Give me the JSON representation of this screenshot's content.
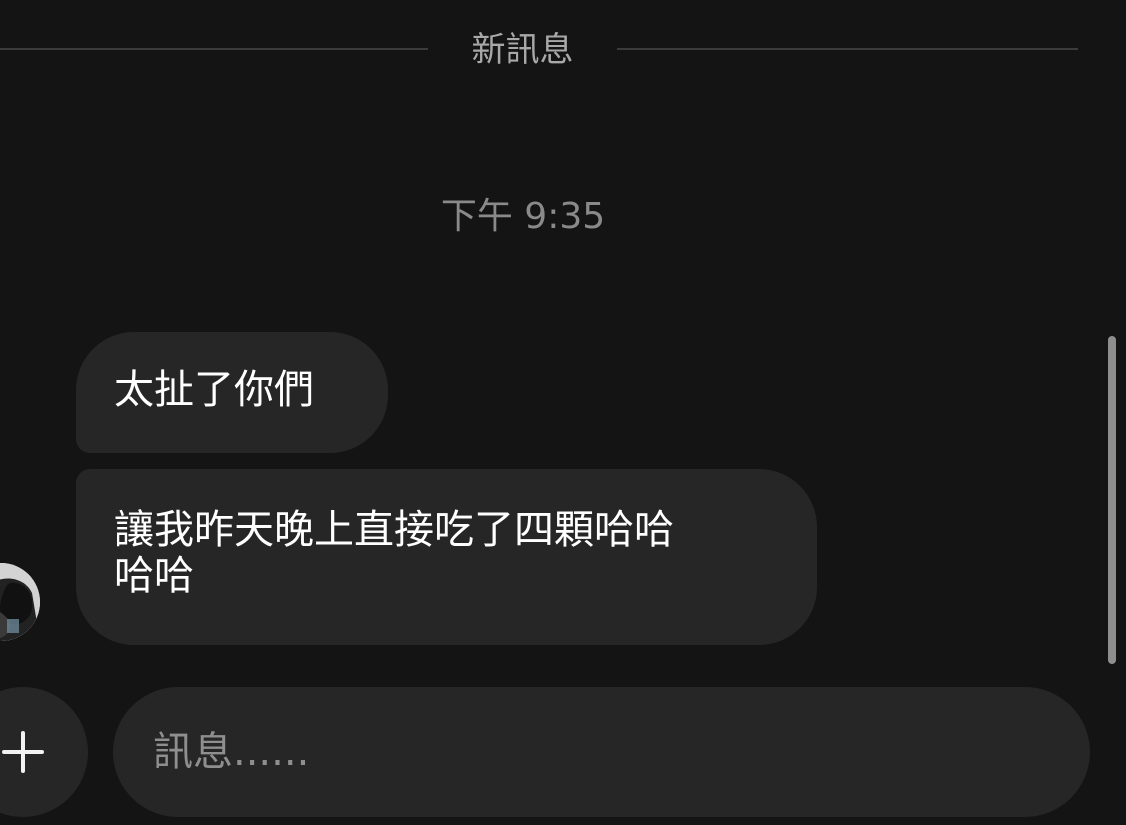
{
  "divider": {
    "label": "新訊息"
  },
  "timestamp": "下午 9:35",
  "messages": [
    {
      "text": "太扯了你們"
    },
    {
      "text": "讓我昨天晚上直接吃了四顆哈哈\n哈哈"
    }
  ],
  "composer": {
    "placeholder": "訊息......",
    "add_icon": "plus-icon"
  },
  "colors": {
    "background": "#141414",
    "bubble": "#262626",
    "text": "#ffffff",
    "muted_text": "#8a8a8a"
  }
}
